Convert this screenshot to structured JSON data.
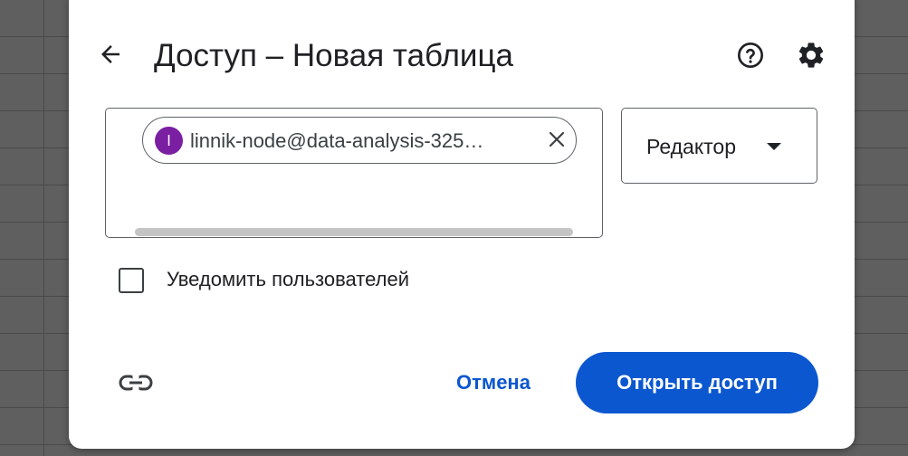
{
  "dialog": {
    "title": "Доступ – Новая таблица",
    "back_icon": "arrow-back-icon",
    "help_icon": "help-icon",
    "settings_icon": "gear-icon"
  },
  "recipients": {
    "chips": [
      {
        "avatar_letter": "l",
        "email": "linnik-node@data-analysis-3251…",
        "avatar_color": "#7b1fa2"
      }
    ],
    "remove_icon": "close-icon"
  },
  "role": {
    "selected": "Редактор",
    "caret_icon": "caret-down-icon"
  },
  "notify": {
    "label": "Уведомить пользователей",
    "checked": false
  },
  "footer": {
    "link_icon": "link-icon",
    "cancel_label": "Отмена",
    "share_label": "Открыть доступ"
  },
  "colors": {
    "accent": "#0b57d0",
    "avatar": "#7b1fa2",
    "backdrop": "#5f5f5f"
  }
}
